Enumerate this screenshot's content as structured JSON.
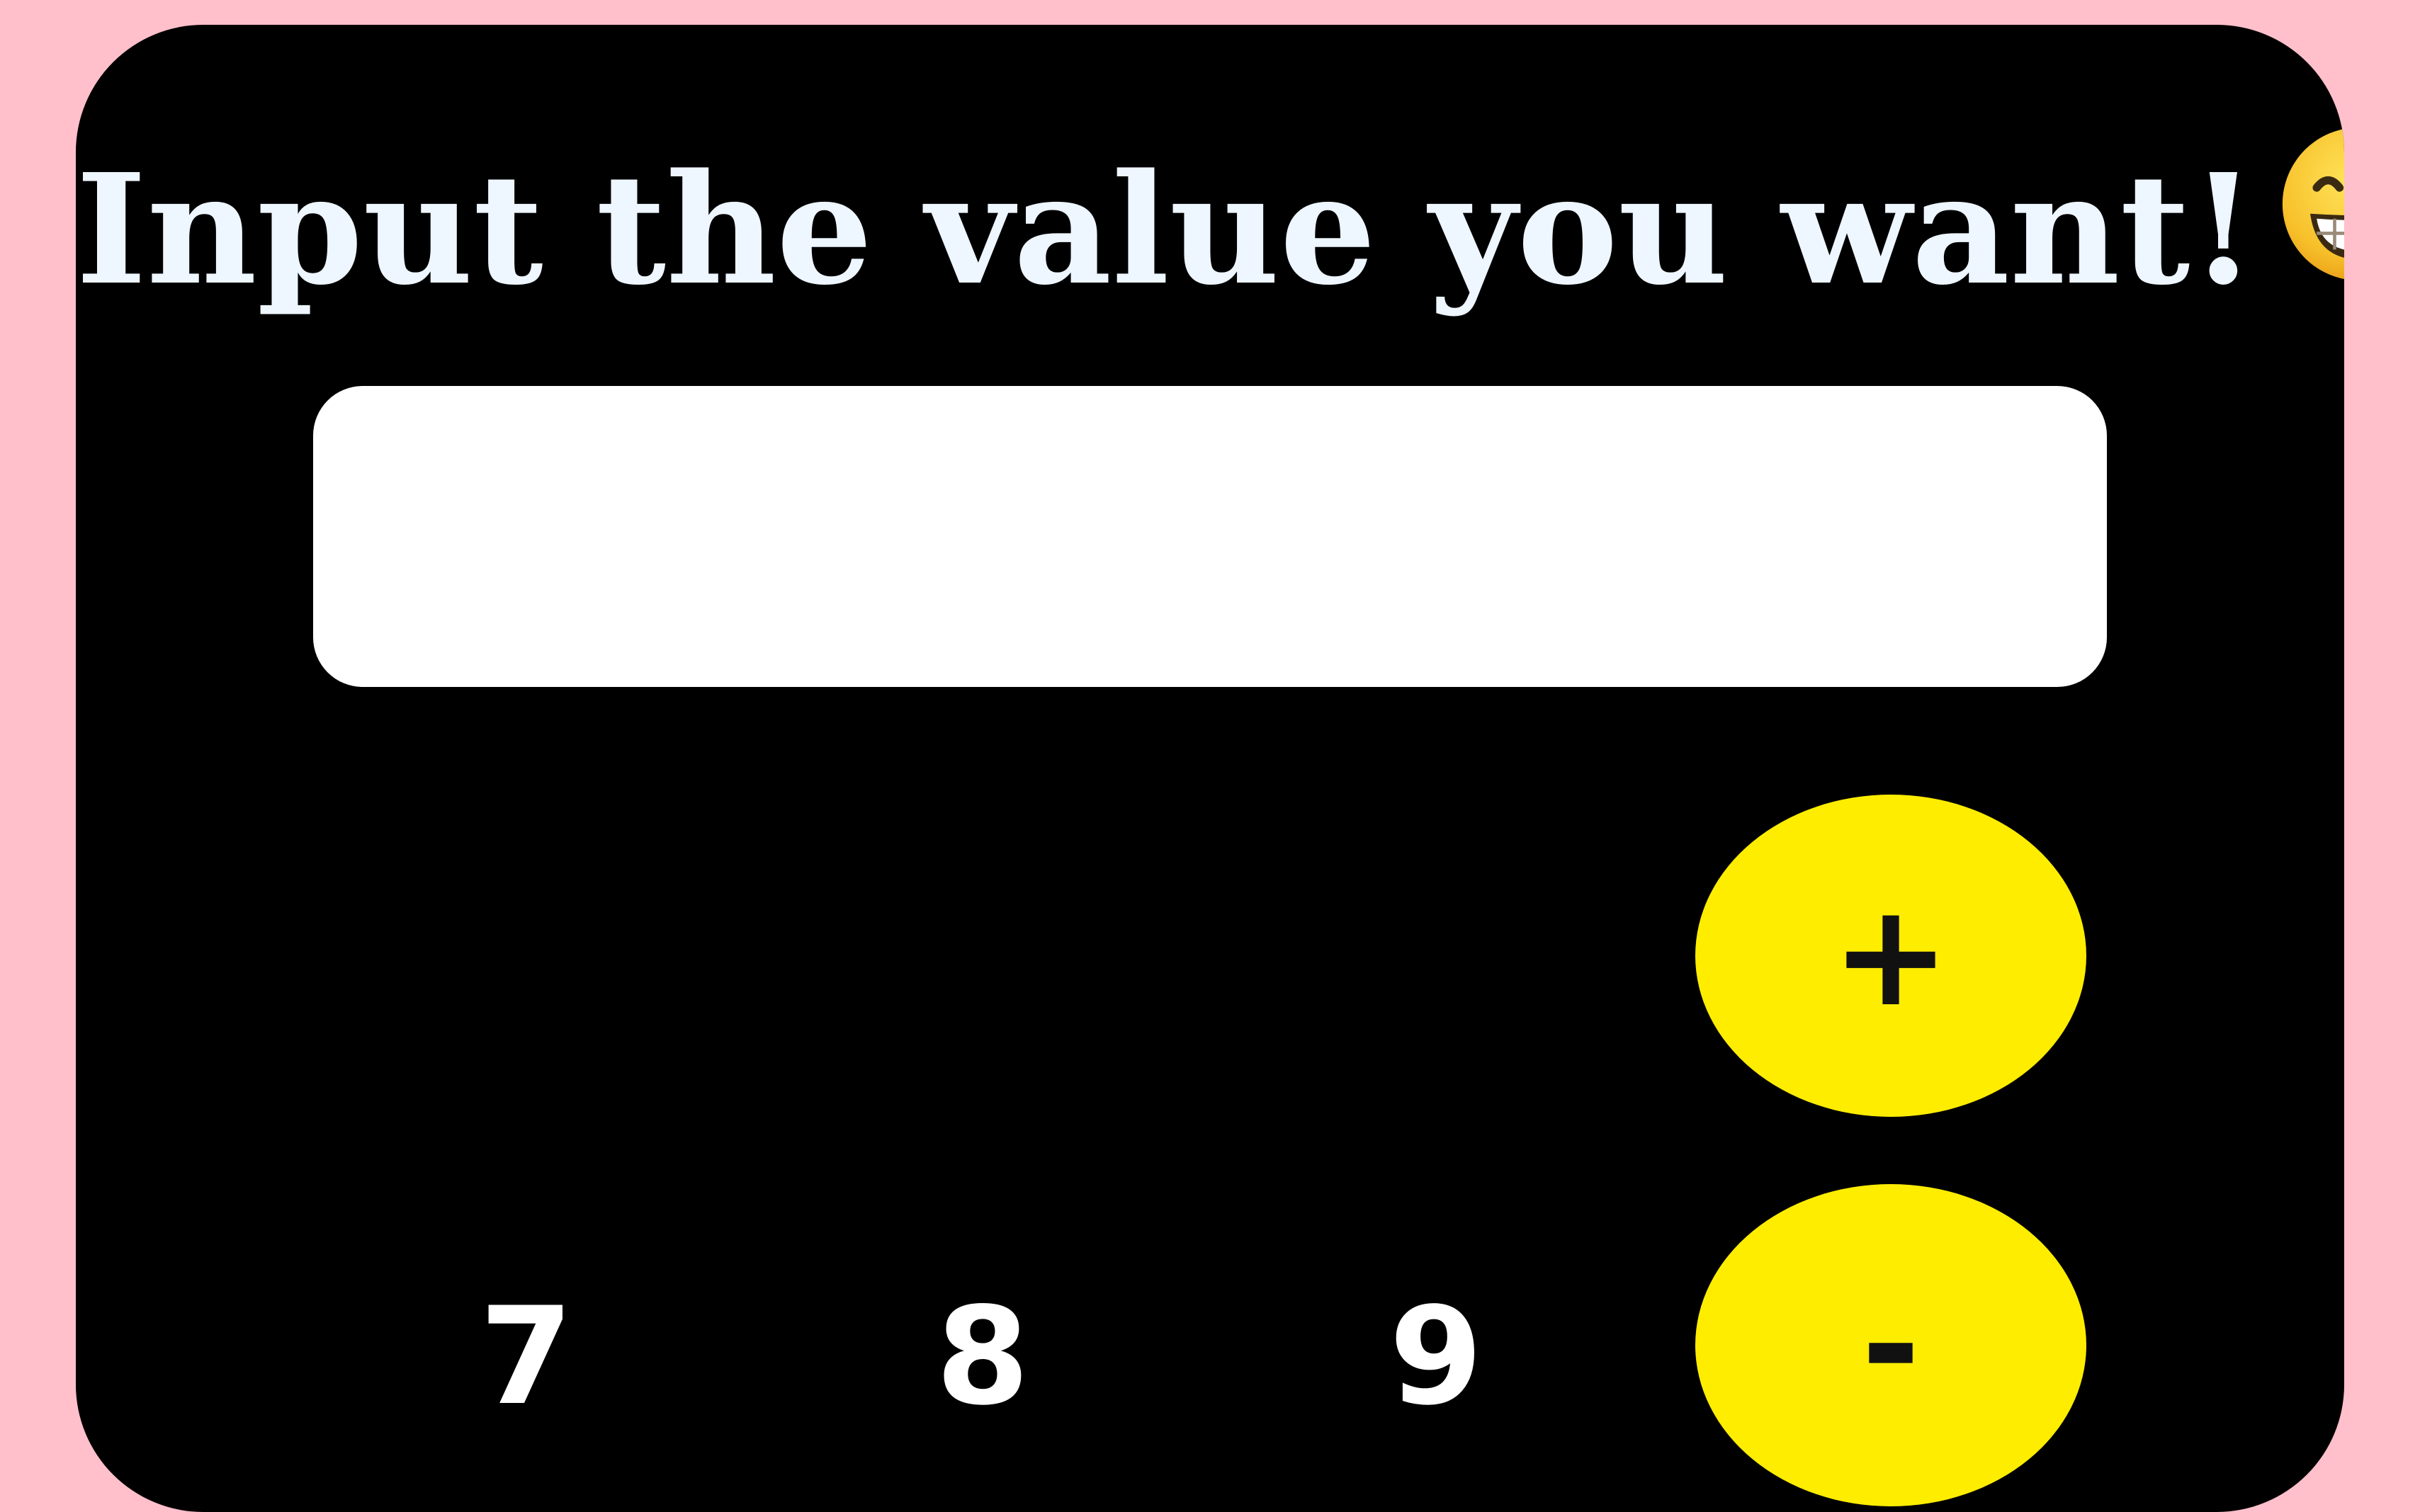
{
  "heading": {
    "text": "Input the value you want!",
    "emoji": "grinning-face-with-smiling-eyes"
  },
  "display": {
    "value": "",
    "placeholder": ""
  },
  "keys": {
    "plus": "+",
    "minus": "-",
    "seven": "7",
    "eight": "8",
    "nine": "9"
  },
  "colors": {
    "page_background": "#ffc0cb",
    "calculator_body": "#000000",
    "heading_text": "#eef6ff",
    "display_background": "#ffffff",
    "operator_key": "#ffed00",
    "operator_key_text": "#111111",
    "digit_key_text": "#ffffff"
  }
}
